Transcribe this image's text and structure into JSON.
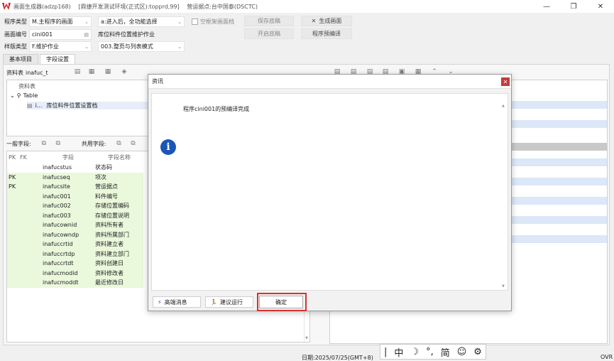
{
  "titlebar": {
    "app_title": "画面生成器(adzp168)",
    "env": "[鼎捷开发测试环境(正式区):topprd,99]",
    "site": "营运据点:台中国泰(DSCTC)",
    "minimize": "—",
    "restore": "❐",
    "close": "✕"
  },
  "form": {
    "prog_type_label": "程序类型",
    "prog_type_value": "M.主程序的画面",
    "entry_value": "a:进入后，全功能选择",
    "empty_frame_label": "空框架画面档",
    "save_draft": "保存底稿",
    "gen_screen": "生成画面",
    "screen_no_label": "画面编号",
    "screen_no_value": "cini001",
    "screen_desc": "库位料件位置维护作业",
    "open_draft": "开启底稿",
    "pre_compile": "程序预编译",
    "style_type_label": "样版类型",
    "style_type_value": "F.维护作业",
    "style_mode_value": "003.整页与列表模式"
  },
  "tabs": [
    {
      "label": "基本项目"
    },
    {
      "label": "字段设置"
    }
  ],
  "datatable": {
    "label": "资料表",
    "value": "inafuc_t"
  },
  "tree": {
    "header": "资料表",
    "root": "Table",
    "child_short": "i...",
    "child_desc": "库位料件位置设置档"
  },
  "fields_section": {
    "general_label": "一般字段:",
    "shared_label": "共用字段:"
  },
  "grid": {
    "headers": {
      "pk": "PK",
      "fk": "FK",
      "field": "字段",
      "name": "字段名称"
    },
    "rows": [
      {
        "pk": "",
        "field": "inafucstus",
        "name": "状态码"
      },
      {
        "pk": "PK",
        "field": "inafucseq",
        "name": "项次"
      },
      {
        "pk": "PK",
        "field": "inafucsite",
        "name": "营运据点"
      },
      {
        "pk": "",
        "field": "inafuc001",
        "name": "料件编号"
      },
      {
        "pk": "",
        "field": "inafuc002",
        "name": "存储位置编码"
      },
      {
        "pk": "",
        "field": "inafuc003",
        "name": "存储位置说明"
      },
      {
        "pk": "",
        "field": "inafucownid",
        "name": "资料所有者"
      },
      {
        "pk": "",
        "field": "inafucowndp",
        "name": "资料所属部门"
      },
      {
        "pk": "",
        "field": "inafuccrtid",
        "name": "资料建立者"
      },
      {
        "pk": "",
        "field": "inafuccrtdp",
        "name": "资料建立部门"
      },
      {
        "pk": "",
        "field": "inafuccrtdt",
        "name": "资料创建日"
      },
      {
        "pk": "",
        "field": "inafucmodid",
        "name": "资料修改者"
      },
      {
        "pk": "",
        "field": "inafucmoddt",
        "name": "最近修改日"
      }
    ]
  },
  "dialog": {
    "title": "资讯",
    "message": "程序cini001的预编译完成",
    "btn_high_end": "高端消息",
    "btn_suggest": "建议运行",
    "btn_ok": "确定"
  },
  "status": {
    "date": "日期:2025/07/25(GMT+8)",
    "ovr": "OVR"
  },
  "ime": {
    "cursor": "|",
    "lang": "中",
    "moon": "☽",
    "punct": "°,",
    "simp": "简",
    "emoji": "☺",
    "gear": "⚙"
  }
}
